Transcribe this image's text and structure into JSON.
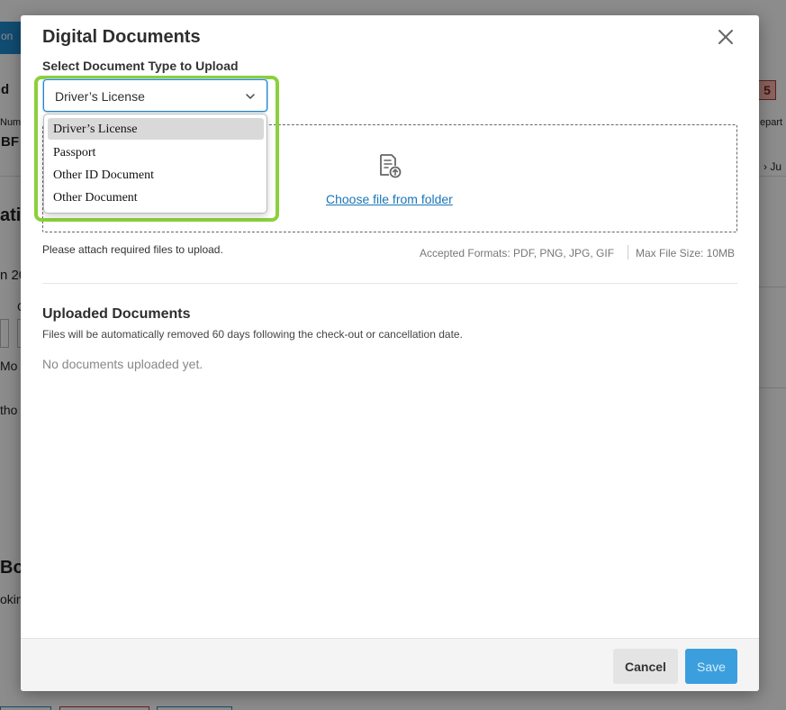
{
  "background": {
    "fragments": [
      "on",
      "d",
      "Num",
      "BF",
      "ati",
      "n 20",
      "C",
      "Mo",
      "tho",
      "Boo",
      "okin",
      "5",
      "epart",
      "Ju"
    ]
  },
  "modal": {
    "title": "Digital Documents",
    "close_icon": "close-icon",
    "field_label": "Select Document Type to Upload",
    "select": {
      "value": "Driver’s License",
      "options": [
        "Driver’s License",
        "Passport",
        "Other ID Document",
        "Other Document"
      ]
    },
    "dropzone": {
      "icon": "file-upload-icon",
      "link_label": "Choose file from folder"
    },
    "attach_note": "Please attach required files to upload.",
    "accepted_formats": "Accepted Formats: PDF, PNG, JPG, GIF",
    "max_size": "Max File Size: 10MB",
    "uploaded": {
      "title": "Uploaded Documents",
      "subtitle": "Files will be automatically removed 60 days following the check-out or cancellation date.",
      "empty": "No documents uploaded yet."
    },
    "footer": {
      "cancel_label": "Cancel",
      "save_label": "Save"
    }
  },
  "colors": {
    "accent": "#3b9fde",
    "link": "#1a76b5",
    "highlight": "#8bd03c"
  }
}
